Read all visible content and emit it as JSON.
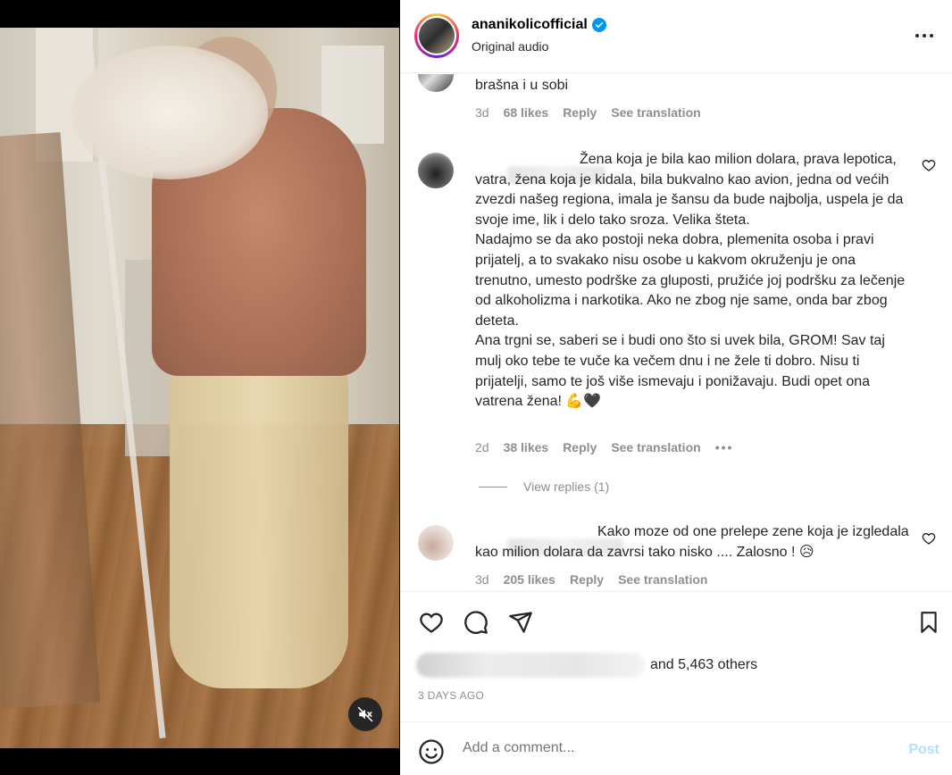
{
  "post": {
    "username": "ananikolicofficial",
    "subtitle": "Original audio",
    "liked_by_others": "and 5,463 others",
    "date": "3 DAYS AGO"
  },
  "comments": [
    {
      "text": "brašna i u sobi",
      "time": "3d",
      "likes": "68 likes",
      "reply": "Reply",
      "translation": "See translation"
    },
    {
      "text": "Žena koja je bila kao milion dolara, prava lepotica, vatra, žena koja je kidala, bila bukvalno kao avion, jedna od većih zvezdi našeg regiona, imala je šansu da bude najbolja, uspela je da svoje ime, lik i delo tako sroza. Velika šteta.\nNadajmo se da ako postoji neka dobra, plemenita osoba i pravi prijatelj, a to svakako nisu osobe u kakvom okruženju je ona trenutno, umesto podrške za gluposti, pružiće joj podršku za lečenje od alkoholizma i narkotika. Ako ne zbog nje same, onda bar zbog deteta.\nAna trgni se, saberi se i budi ono što si uvek bila, GROM! Sav taj mulj oko tebe te vuče ka večem dnu i ne žele ti dobro. Nisu ti prijatelji, samo te još više ismevaju i ponižavaju. Budi opet ona vatrena žena! 💪🖤",
      "time": "2d",
      "likes": "38 likes",
      "reply": "Reply",
      "translation": "See translation",
      "view_replies": "View replies (1)"
    },
    {
      "text": "Kako moze od one prelepe zene koja je izgledala kao milion dolara da zavrsi tako nisko .... Zalosno ! 😥",
      "time": "3d",
      "likes": "205 likes",
      "reply": "Reply",
      "translation": "See translation"
    }
  ],
  "comment_box": {
    "placeholder": "Add a comment...",
    "post_label": "Post"
  },
  "colors": {
    "accent": "#0095f6",
    "post_disabled": "#b2dffc",
    "muted": "#8e8e8e"
  },
  "icons": [
    "muted-speaker-icon",
    "verified-badge-icon",
    "more-icon",
    "heart-icon",
    "comment-icon",
    "share-icon",
    "bookmark-icon",
    "emoji-icon"
  ]
}
